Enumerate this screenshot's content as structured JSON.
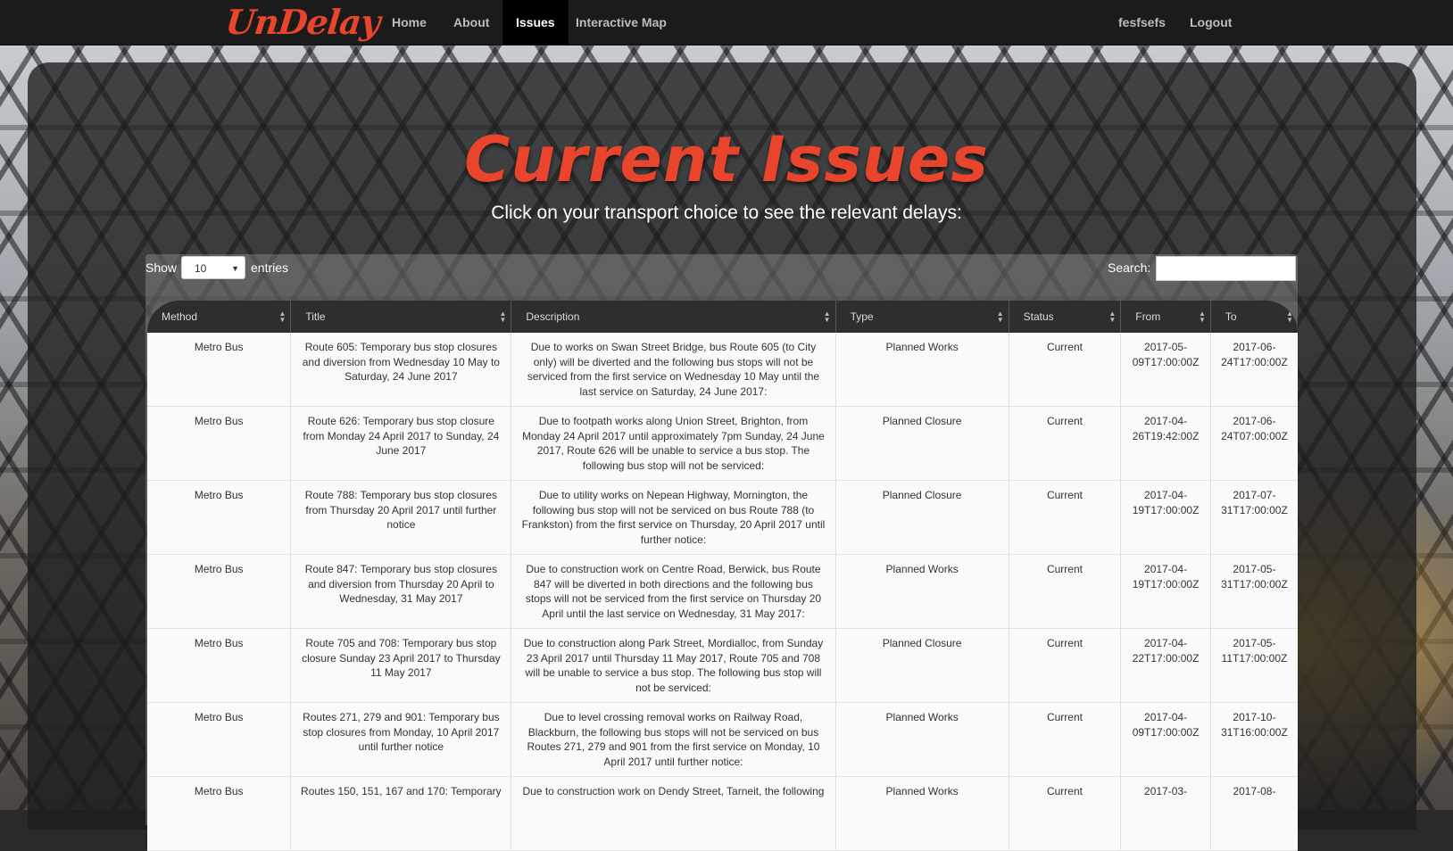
{
  "nav": {
    "brand": "UnDelay",
    "items": [
      "Home",
      "About",
      "Issues",
      "Interactive Map"
    ],
    "active": "Issues",
    "user": "fesfsefs",
    "logout": "Logout"
  },
  "page": {
    "title": "Current Issues",
    "subtitle": "Click on your transport choice to see the relevant delays:"
  },
  "table_controls": {
    "show_label": "Show",
    "entries_value": "10",
    "entries_label": "entries",
    "search_label": "Search:",
    "search_value": ""
  },
  "table": {
    "columns": [
      "Method",
      "Title",
      "Description",
      "Type",
      "Status",
      "From",
      "To"
    ],
    "rows": [
      [
        "Metro Bus",
        "Route 605: Temporary bus stop closures and diversion from Wednesday 10 May to Saturday, 24 June 2017",
        "Due to works on Swan Street Bridge, bus Route 605 (to City only) will be diverted and the following bus stops will not be serviced from the first service on Wednesday 10 May until the last service on Saturday, 24 June 2017:",
        "Planned Works",
        "Current",
        "2017-05-09T17:00:00Z",
        "2017-06-24T17:00:00Z"
      ],
      [
        "Metro Bus",
        "Route 626: Temporary bus stop closure from Monday 24 April 2017 to Sunday, 24 June 2017",
        "Due to footpath works along Union Street, Brighton, from Monday 24 April 2017 until approximately 7pm Sunday, 24 June 2017, Route 626 will be unable to service a bus stop. The following bus stop will not be serviced:",
        "Planned Closure",
        "Current",
        "2017-04-26T19:42:00Z",
        "2017-06-24T07:00:00Z"
      ],
      [
        "Metro Bus",
        "Route 788: Temporary bus stop closures from Thursday 20 April 2017 until further notice",
        "Due to utility works on Nepean Highway, Mornington, the following bus stop will not be serviced on bus Route 788 (to Frankston) from the first service on Thursday, 20 April 2017 until further notice:",
        "Planned Closure",
        "Current",
        "2017-04-19T17:00:00Z",
        "2017-07-31T17:00:00Z"
      ],
      [
        "Metro Bus",
        "Route 847: Temporary bus stop closures and diversion from Thursday 20 April to Wednesday, 31 May 2017",
        "Due to construction work on Centre Road, Berwick, bus Route 847 will be diverted in both directions and the following bus stops will not be serviced from the first service on Thursday 20 April until the last service on Wednesday, 31 May 2017:",
        "Planned Works",
        "Current",
        "2017-04-19T17:00:00Z",
        "2017-05-31T17:00:00Z"
      ],
      [
        "Metro Bus",
        "Route 705 and 708: Temporary bus stop closure Sunday 23 April 2017 to Thursday 11 May 2017",
        "Due to construction along Park Street, Mordialloc, from Sunday 23 April 2017 until Thursday 11 May 2017, Route 705 and 708 will be unable to service a bus stop. The following bus stop will not be serviced:",
        "Planned Closure",
        "Current",
        "2017-04-22T17:00:00Z",
        "2017-05-11T17:00:00Z"
      ],
      [
        "Metro Bus",
        "Routes 271, 279 and 901: Temporary bus stop closures from Monday, 10 April 2017 until further notice",
        "Due to level crossing removal works on Railway Road, Blackburn, the following bus stops will not be serviced on bus Routes 271, 279 and 901 from the first service on Monday, 10 April 2017 until further notice:",
        "Planned Works",
        "Current",
        "2017-04-09T17:00:00Z",
        "2017-10-31T16:00:00Z"
      ],
      [
        "Metro Bus",
        "Routes 150, 151, 167 and 170: Temporary",
        "Due to construction work on Dendy Street, Tarneit, the following",
        "Planned Works",
        "Current",
        "2017-03-",
        "2017-08-"
      ]
    ]
  }
}
